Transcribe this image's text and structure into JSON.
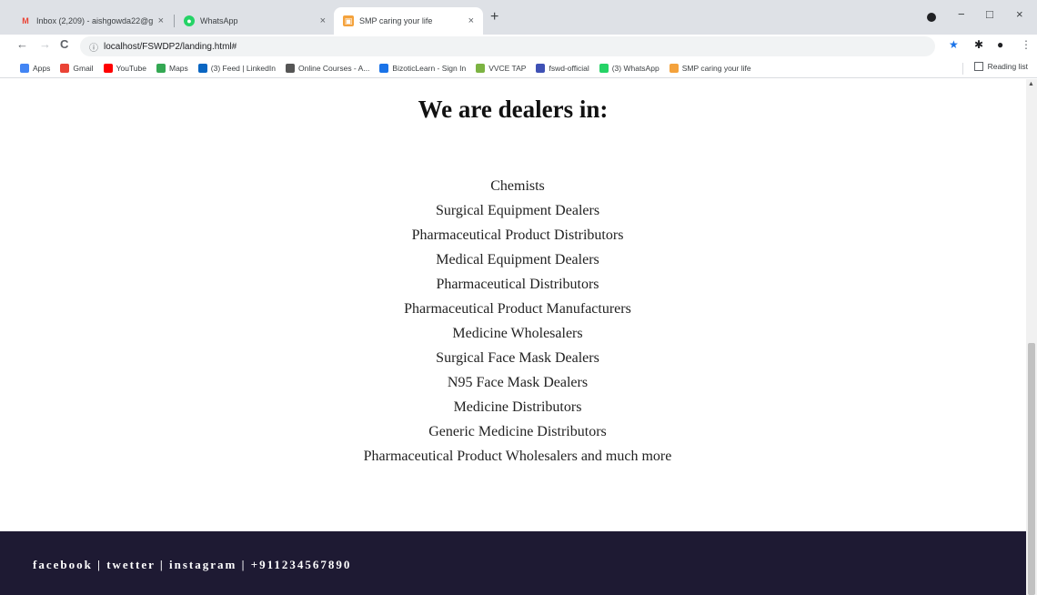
{
  "tabs": [
    {
      "label": "Inbox (2,209) - aishgowda22@g",
      "close": "×"
    },
    {
      "label": "WhatsApp",
      "close": "×"
    },
    {
      "label": "SMP caring your life",
      "close": "×"
    }
  ],
  "new_tab": "+",
  "window_controls": {
    "minimize": "−",
    "maximize": "□",
    "close": "×"
  },
  "toolbar": {
    "back": "←",
    "forward": "→",
    "reload": "C",
    "url": "localhost/FSWDP2/landing.html#",
    "info": "ⓘ"
  },
  "bookmarks": [
    {
      "label": "Apps",
      "color": "#4285f4"
    },
    {
      "label": "Gmail",
      "color": "#ea4335"
    },
    {
      "label": "YouTube",
      "color": "#ff0000"
    },
    {
      "label": "Maps",
      "color": "#34a853"
    },
    {
      "label": "(3) Feed | LinkedIn",
      "color": "#0a66c2"
    },
    {
      "label": "Online Courses - A...",
      "color": "#555555"
    },
    {
      "label": "BizoticLearn - Sign In",
      "color": "#1a73e8"
    },
    {
      "label": "VVCE TAP",
      "color": "#7cb342"
    },
    {
      "label": "fswd-official",
      "color": "#3f51b5"
    },
    {
      "label": "(3) WhatsApp",
      "color": "#25d366"
    },
    {
      "label": "SMP caring your life",
      "color": "#f4a23c"
    }
  ],
  "reading_list": "Reading list",
  "main": {
    "heading": "We are dealers in:",
    "dealers": [
      "Chemists",
      "Surgical Equipment Dealers",
      "Pharmaceutical Product Distributors",
      "Medical Equipment Dealers",
      "Pharmaceutical Distributors",
      "Pharmaceutical Product Manufacturers",
      "Medicine Wholesalers",
      "Surgical Face Mask Dealers",
      "N95 Face Mask Dealers",
      "Medicine Distributors",
      "Generic Medicine Distributors",
      "Pharmaceutical Product Wholesalers and much more"
    ]
  },
  "footer": {
    "text": "facebook | twetter | instagram | +911234567890",
    "background": "#1e1a33"
  }
}
